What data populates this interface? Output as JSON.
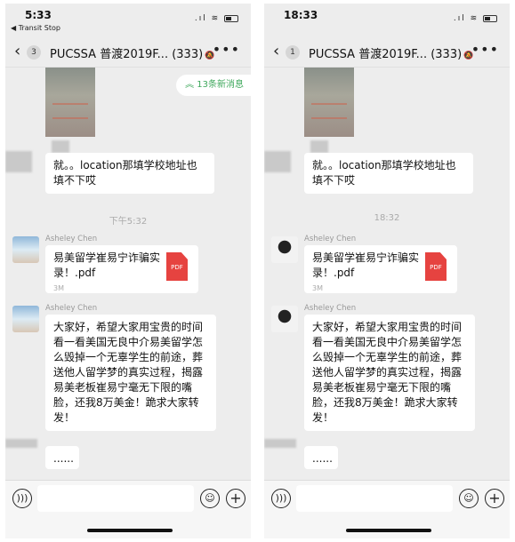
{
  "phones": [
    {
      "status": {
        "time": "5:33",
        "back_app": "◀ Transit Stop"
      },
      "nav": {
        "back_badge": "3",
        "title": "PUCSSA 普渡2019F... (333)"
      },
      "new_messages": "13条新消息",
      "messages": {
        "partial": "就。。location那填学校地址也填不下哎",
        "timestamp": "下午5:32",
        "sender": "Asheley Chen",
        "file_name": "易美留学崔易宁诈骗实录！.pdf",
        "file_size": "3M",
        "file_icon": "PDF",
        "long_text": "大家好，希望大家用宝贵的时间看一看美国无良中介易美留学怎么毁掉一个无辜学生的前途，葬送他人留学梦的真实过程，揭露易美老板崔易宁毫无下限的嘴脸，还我8万美金！跪求大家转发！",
        "last": "......"
      }
    },
    {
      "status": {
        "time": "18:33",
        "back_app": ""
      },
      "nav": {
        "back_badge": "1",
        "title": "PUCSSA 普渡2019F... (333)"
      },
      "new_messages": "",
      "messages": {
        "partial": "就。。location那填学校地址也填不下哎",
        "timestamp": "18:32",
        "sender": "Asheley Chen",
        "file_name": "易美留学崔易宁诈骗实录！.pdf",
        "file_size": "3M",
        "file_icon": "PDF",
        "long_text": "大家好，希望大家用宝贵的时间看一看美国无良中介易美留学怎么毁掉一个无辜学生的前途，葬送他人留学梦的真实过程，揭露易美老板崔易宁毫无下限的嘴脸，还我8万美金！跪求大家转发！",
        "last": "......"
      }
    }
  ],
  "icons": {
    "voice": "voice-icon",
    "emoji": "emoji-icon",
    "plus": "plus-icon",
    "more": "more-icon",
    "mute": "mute-bell-icon"
  },
  "colors": {
    "accent_green": "#3fa85c",
    "pdf_red": "#e64340",
    "chat_bg": "#ededed"
  }
}
